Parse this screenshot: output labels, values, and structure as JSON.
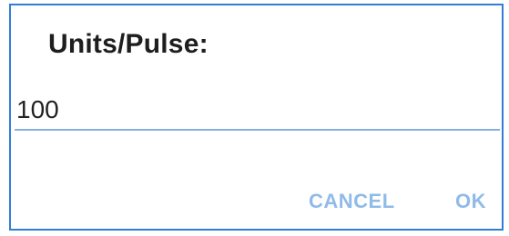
{
  "dialog": {
    "title": "Units/Pulse:",
    "input": {
      "value": "100",
      "placeholder": ""
    },
    "buttons": {
      "cancel_label": "CANCEL",
      "ok_label": "OK"
    }
  },
  "colors": {
    "border": "#2f7fd6",
    "input_underline": "#86afe0",
    "button_text": "#8fbbe8",
    "title_text": "#1e1e1e"
  }
}
